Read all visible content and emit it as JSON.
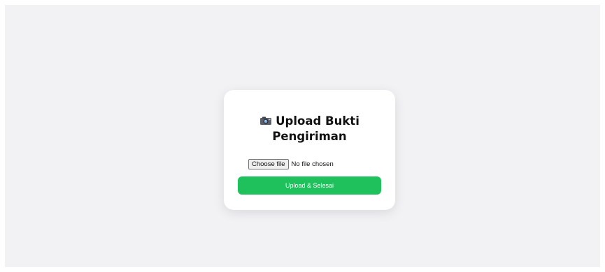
{
  "upload_card": {
    "icon": "camera-icon",
    "title_line1": "Upload Bukti",
    "title_line2": "Pengiriman",
    "file_input": {
      "button_label": "Choose file",
      "status_text": "No file chosen"
    },
    "submit_label": "Upload & Selesai",
    "colors": {
      "background": "#f2f2f5",
      "card": "#ffffff",
      "accent": "#1ec15b"
    }
  }
}
